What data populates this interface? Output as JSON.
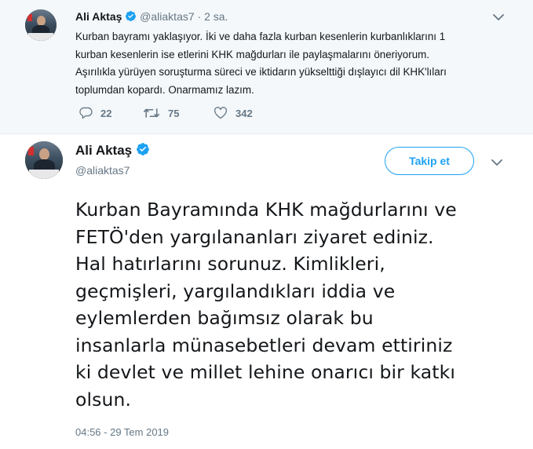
{
  "tweet1": {
    "name": "Ali Aktaş",
    "handle": "@aliaktas7",
    "time_sep": "·",
    "time": "2 sa.",
    "text_lines": [
      "Kurban bayramı yaklaşıyor. İki ve daha fazla kurban kesenlerin kurbanlıklarını 1",
      "kurban kesenlerin ise etlerini KHK mağdurları ile paylaşmalarını öneriyorum.",
      "Aşırılıkla yürüyen soruşturma süreci ve iktidarın yükselttiği dışlayıcı dil KHK'lıları",
      "toplumdan kopardı. Onarmamız lazım."
    ],
    "replies": "22",
    "retweets": "75",
    "likes": "342",
    "icons": {
      "reply": "reply-icon",
      "retweet": "retweet-icon",
      "like": "heart-icon",
      "more": "chevron-down-icon"
    }
  },
  "tweet2": {
    "name": "Ali Aktaş",
    "handle": "@aliaktas7",
    "follow_label": "Takip et",
    "text_lines": [
      "Kurban Bayramında KHK mağdurlarını ve",
      "FETÖ'den yargılananları ziyaret ediniz.",
      "Hal hatırlarını sorunuz. Kimlikleri,",
      "geçmişleri, yargılandıkları iddia ve",
      "eylemlerden bağımsız olarak bu",
      "insanlarla münasebetleri devam ettiriniz",
      "ki devlet ve millet lehine onarıcı bir katkı",
      "olsun."
    ],
    "timestamp": "04:56 - 29 Tem 2019"
  },
  "colors": {
    "accent": "#1da1f2",
    "muted": "#657786",
    "text": "#14171a",
    "bg_top": "#f5f8fa"
  }
}
